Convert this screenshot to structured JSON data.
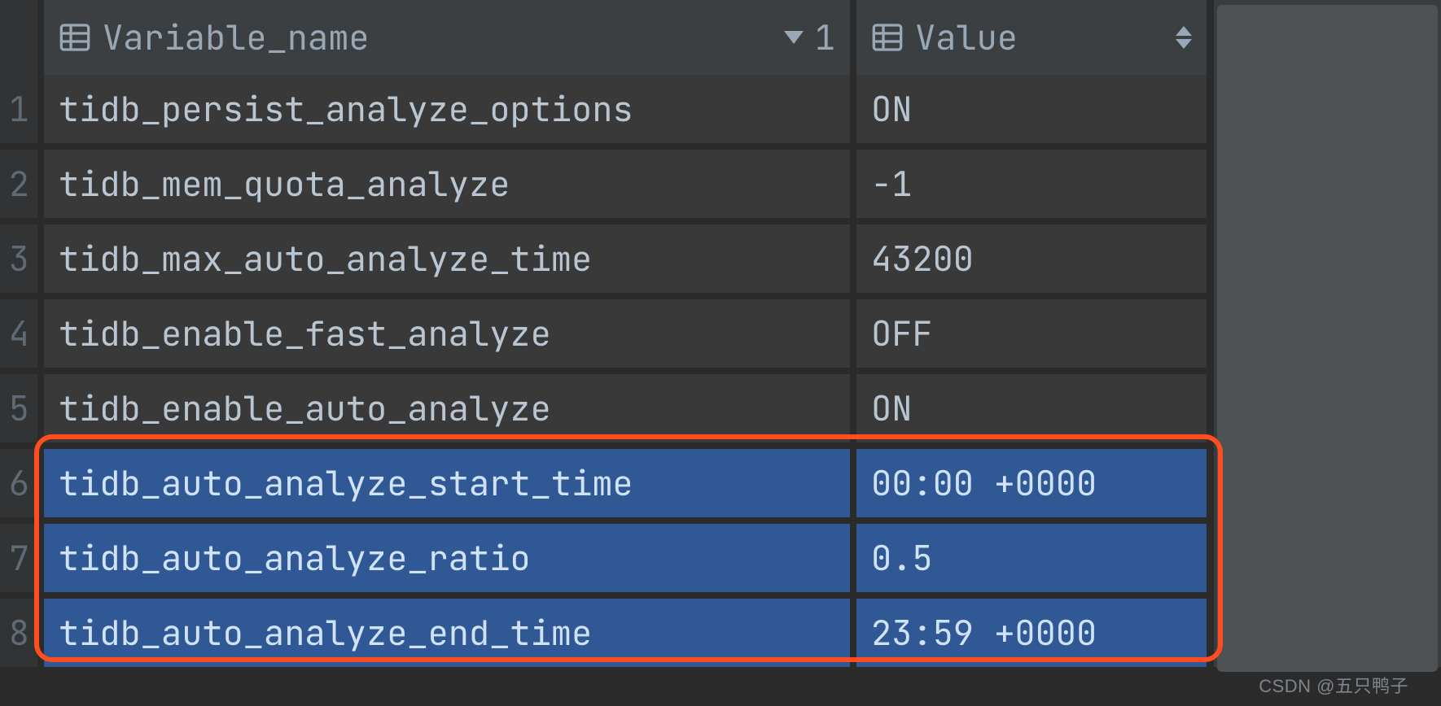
{
  "columns": {
    "variable": "Variable_name",
    "value": "Value",
    "sort_index": "1"
  },
  "rows": [
    {
      "n": "1",
      "var": "tidb_persist_analyze_options",
      "val": "ON",
      "sel": false
    },
    {
      "n": "2",
      "var": "tidb_mem_quota_analyze",
      "val": "-1",
      "sel": false
    },
    {
      "n": "3",
      "var": "tidb_max_auto_analyze_time",
      "val": "43200",
      "sel": false
    },
    {
      "n": "4",
      "var": "tidb_enable_fast_analyze",
      "val": "OFF",
      "sel": false
    },
    {
      "n": "5",
      "var": "tidb_enable_auto_analyze",
      "val": "ON",
      "sel": false
    },
    {
      "n": "6",
      "var": "tidb_auto_analyze_start_time",
      "val": "00:00 +0000",
      "sel": true
    },
    {
      "n": "7",
      "var": "tidb_auto_analyze_ratio",
      "val": "0.5",
      "sel": true
    },
    {
      "n": "8",
      "var": "tidb_auto_analyze_end_time",
      "val": "23:59 +0000",
      "sel": true
    }
  ],
  "watermark": "CSDN @五只鸭子",
  "colors": {
    "selection": "#2f5895",
    "highlight_box": "#ff4d1f"
  }
}
